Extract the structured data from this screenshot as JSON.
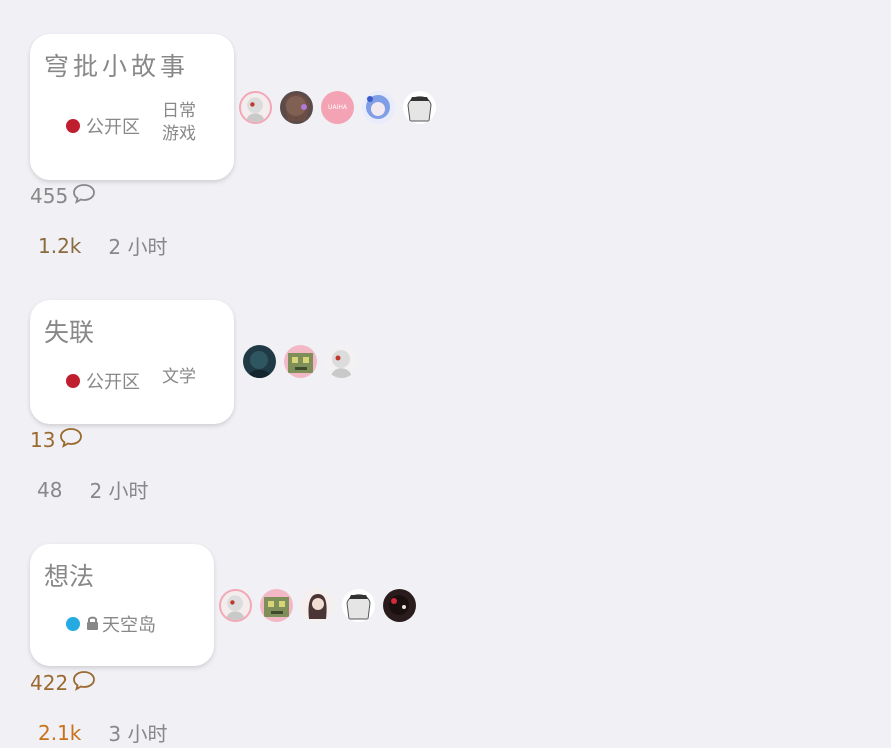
{
  "topics": [
    {
      "title": "穹批小故事",
      "category": {
        "name": "公开区",
        "color": "#bf1e2e",
        "locked": false
      },
      "tags": [
        "日常",
        "游戏"
      ],
      "posters": [
        {
          "name": "poster-1",
          "style": "white-hair"
        },
        {
          "name": "poster-2",
          "style": "brown-hair"
        },
        {
          "name": "poster-3",
          "style": "pink-letter",
          "letter": "UAIHA"
        },
        {
          "name": "poster-4",
          "style": "blue-hair"
        },
        {
          "name": "poster-5",
          "style": "monochrome"
        }
      ],
      "replies": "455",
      "replies_color": "#888888",
      "views": "1.2k",
      "views_color": "#8a6a3e",
      "age": "2 小时"
    },
    {
      "title": "失联",
      "category": {
        "name": "公开区",
        "color": "#bf1e2e",
        "locked": false
      },
      "tags": [
        "文学"
      ],
      "posters": [
        {
          "name": "poster-1",
          "style": "dark-teal"
        },
        {
          "name": "poster-2",
          "style": "pixel-cat"
        },
        {
          "name": "poster-3",
          "style": "white-hair"
        }
      ],
      "replies": "13",
      "replies_color": "#9a6a30",
      "views": "48",
      "views_color": "#888888",
      "age": "2 小时"
    },
    {
      "title": "想法",
      "category": {
        "name": "天空岛",
        "color": "#25aae1",
        "locked": true
      },
      "tags": [],
      "posters": [
        {
          "name": "poster-1",
          "style": "white-hair"
        },
        {
          "name": "poster-2",
          "style": "pixel-cat"
        },
        {
          "name": "poster-3",
          "style": "dark-girl"
        },
        {
          "name": "poster-4",
          "style": "monochrome"
        },
        {
          "name": "poster-5",
          "style": "black-red"
        }
      ],
      "replies": "422",
      "replies_color": "#9a6a30",
      "views": "2.1k",
      "views_color": "#c8731a",
      "age": "3 小时"
    }
  ]
}
